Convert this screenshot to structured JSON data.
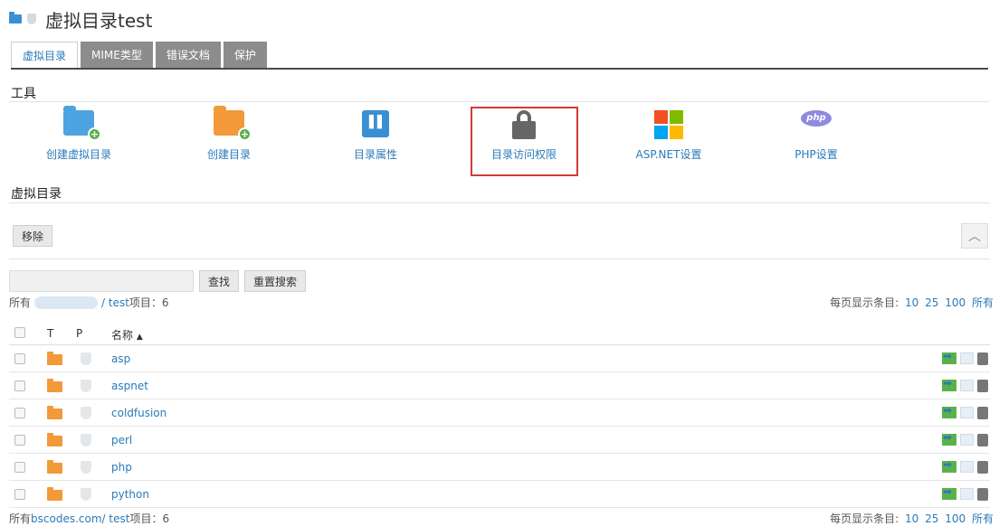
{
  "header": {
    "title": "虚拟目录test"
  },
  "tabs": [
    {
      "label": "虚拟目录",
      "active": true
    },
    {
      "label": "MIME类型",
      "active": false
    },
    {
      "label": "错误文档",
      "active": false
    },
    {
      "label": "保护",
      "active": false
    }
  ],
  "tools_section": {
    "title": "工具",
    "items": [
      {
        "label": "创建虚拟目录",
        "icon": "folder-add-icon"
      },
      {
        "label": "创建目录",
        "icon": "folder-add-icon"
      },
      {
        "label": "目录属性",
        "icon": "properties-icon"
      },
      {
        "label": "目录访问权限",
        "icon": "lock-icon",
        "highlighted": true
      },
      {
        "label": "ASP.NET设置",
        "icon": "windows-icon"
      },
      {
        "label": "PHP设置",
        "icon": "php-icon"
      }
    ]
  },
  "vdir_section": {
    "title": "虚拟目录"
  },
  "toolbar": {
    "remove_label": "移除",
    "collapse_symbol": "︿"
  },
  "search": {
    "placeholder": "",
    "find_label": "查找",
    "reset_label": "重置搜索"
  },
  "summary_top": {
    "prefix": "所有",
    "path": "/ test",
    "items_label": "项目：6"
  },
  "summary_bottom": {
    "prefix": "所有",
    "domain": "bscodes.com",
    "path": " / test",
    "items_label": "项目：6"
  },
  "per_page": {
    "label": "每页显示条目:",
    "options": [
      "10",
      "25",
      "100",
      "所有"
    ]
  },
  "table": {
    "columns": {
      "t": "T",
      "p": "P",
      "name": "名称",
      "sort_indicator": "▲"
    },
    "rows": [
      {
        "name": "asp"
      },
      {
        "name": "aspnet"
      },
      {
        "name": "coldfusion"
      },
      {
        "name": "perl"
      },
      {
        "name": "php"
      },
      {
        "name": "python"
      }
    ]
  },
  "colors": {
    "link": "#2a7ab8",
    "highlight": "#d23a3a",
    "folder_orange": "#f2993a",
    "folder_blue": "#4da3e0",
    "tab_inactive": "#8c8c8c"
  }
}
